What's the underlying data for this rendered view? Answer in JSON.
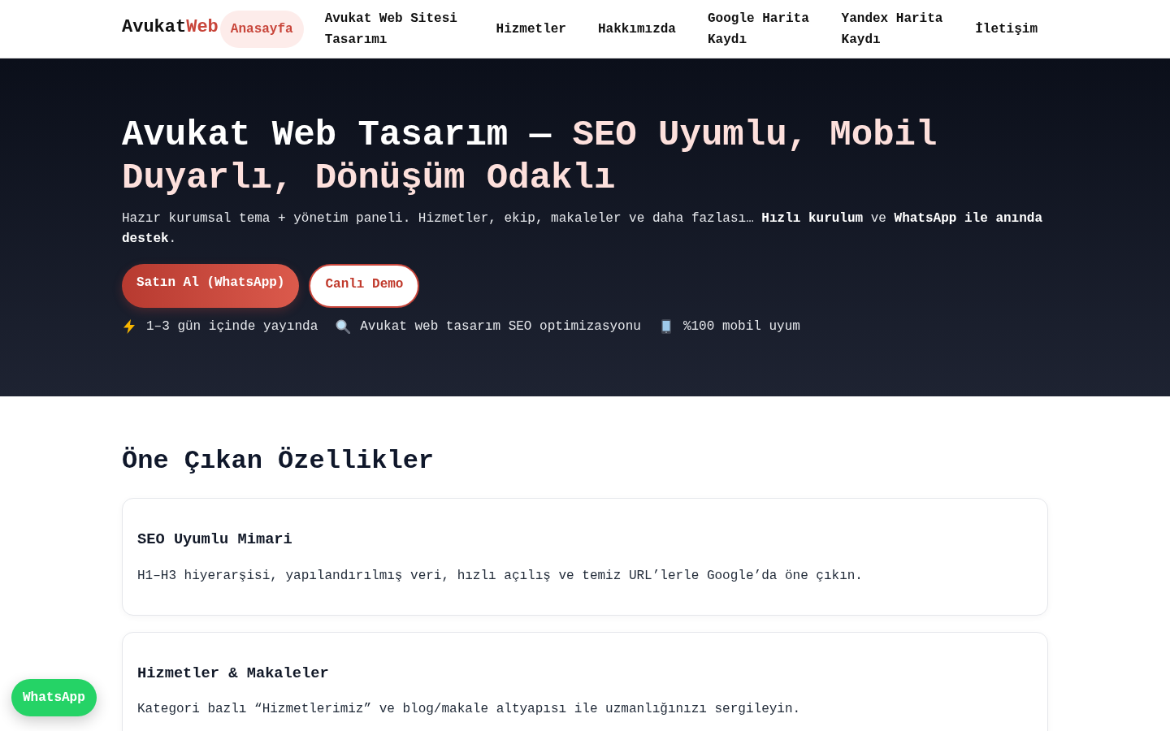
{
  "header": {
    "logo": {
      "text": "Avukat",
      "accent": "Web"
    },
    "nav": [
      {
        "label": "Anasayfa",
        "selected": true
      },
      {
        "label": "Avukat Web Sitesi Tasarımı",
        "selected": false
      },
      {
        "label": "Hizmetler",
        "selected": false
      },
      {
        "label": "Hakkımızda",
        "selected": false
      },
      {
        "label": "Google Harita Kaydı",
        "selected": false
      },
      {
        "label": "Yandex Harita Kaydı",
        "selected": false
      },
      {
        "label": "İletişim",
        "selected": false
      }
    ]
  },
  "hero": {
    "title": {
      "text": "Avukat Web Tasarım —",
      "accent": "SEO Uyumlu, Mobil Duyarlı, Dönüşüm Odaklı"
    },
    "lead": "Hazır kurumsal tema + yönetim paneli. Hizmetler, ekip, makaleler ve daha fazlası… **Hızlı kurulum** ve **WhatsApp ile anında destek**.",
    "buttons": [
      {
        "label": "Satın Al (WhatsApp)",
        "kind": "primary"
      },
      {
        "label": "Canlı Demo",
        "kind": "outline"
      }
    ],
    "highlights": [
      {
        "text": "1–3 gün içinde yayında"
      },
      {
        "text": "Avukat web tasarım SEO optimizasyonu"
      },
      {
        "text": "%100 mobil uyum"
      }
    ]
  },
  "features": {
    "title": "Öne Çıkan Özellikler",
    "cards": [
      {
        "title": "SEO Uyumlu Mimari",
        "text": "H1–H3 hiyerarşisi, yapılandırılmış veri, hızlı açılış ve temiz URL’lerle Google’da öne çıkın."
      },
      {
        "title": "Hizmetler & Makaleler",
        "text": "Kategori bazlı “Hizmetlerimiz” ve blog/makale altyapısı ile uzmanlığınızı sergileyin."
      }
    ]
  },
  "floating_button": {
    "label": "WhatsApp"
  }
}
